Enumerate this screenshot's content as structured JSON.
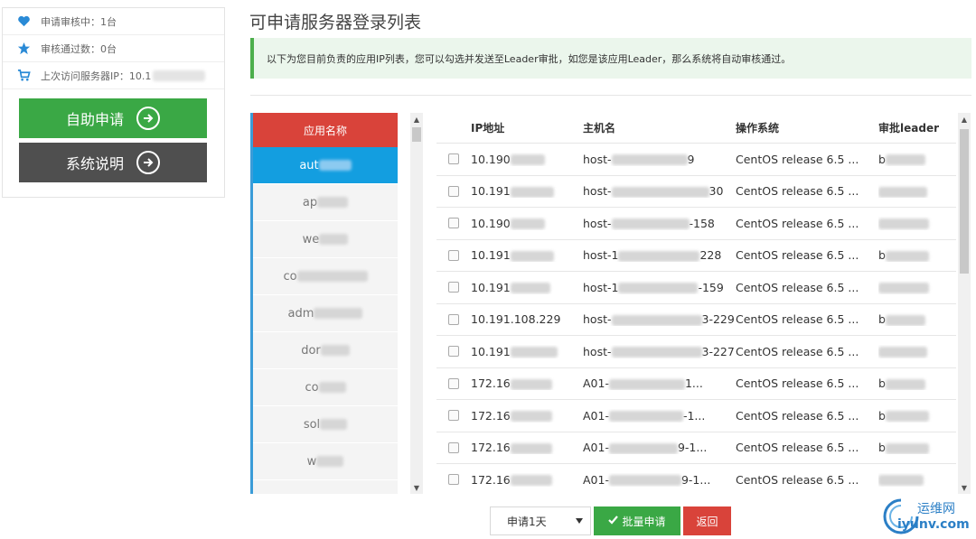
{
  "sidebar": {
    "stats": [
      {
        "icon": "heart-icon",
        "label": "申请审核中：1台"
      },
      {
        "icon": "star-icon",
        "label": "审核通过数：0台"
      },
      {
        "icon": "cart-icon",
        "label": "上次访问服务器IP：10.1"
      }
    ],
    "apply_button": "自助申请",
    "doc_button": "系统说明"
  },
  "page": {
    "title": "可申请服务器登录列表",
    "notice": "以下为您目前负责的应用IP列表，您可以勾选并发送至Leader审批，如您是该应用Leader，那么系统将自动审核通过。"
  },
  "apps": {
    "header": "应用名称",
    "items": [
      {
        "label": "aut",
        "active": true
      },
      {
        "label": "ap"
      },
      {
        "label": "we"
      },
      {
        "label": "co"
      },
      {
        "label": "adm"
      },
      {
        "label": "dor"
      },
      {
        "label": "co"
      },
      {
        "label": "sol"
      },
      {
        "label": "w"
      }
    ]
  },
  "table": {
    "headers": {
      "ip": "IP地址",
      "host": "主机名",
      "os": "操作系统",
      "leader": "审批leader"
    },
    "rows": [
      {
        "ip": "10.190",
        "host": "host-",
        "host_tail": "9",
        "os": "CentOS release 6.5 ...",
        "leader": "b"
      },
      {
        "ip": "10.191",
        "host": "host-",
        "host_tail": "30",
        "os": "CentOS release 6.5 ...",
        "leader": ""
      },
      {
        "ip": "10.190",
        "host": "host-",
        "host_tail": "-158",
        "os": "CentOS release 6.5 ...",
        "leader": ""
      },
      {
        "ip": "10.191",
        "host": "host-1",
        "host_tail": "228",
        "os": "CentOS release 6.5 ...",
        "leader": "b"
      },
      {
        "ip": "10.191",
        "host": "host-1",
        "host_tail": "-159",
        "os": "CentOS release 6.5 ...",
        "leader": ""
      },
      {
        "ip": "10.191.108.229",
        "host": "host-",
        "host_tail": "3-229",
        "os": "CentOS release 6.5 ...",
        "leader": "b"
      },
      {
        "ip": "10.191",
        "host": "host-",
        "host_tail": "3-227",
        "os": "CentOS release 6.5 ...",
        "leader": ""
      },
      {
        "ip": "172.16",
        "host": "A01-",
        "host_tail": "1...",
        "os": "CentOS release 6.5 ...",
        "leader": "b"
      },
      {
        "ip": "172.16",
        "host": "A01-",
        "host_tail": "-1...",
        "os": "CentOS release 6.5 ...",
        "leader": "b"
      },
      {
        "ip": "172.16",
        "host": "A01-",
        "host_tail": "9-1...",
        "os": "CentOS release 6.5 ...",
        "leader": "b"
      },
      {
        "ip": "172.16",
        "host": "A01-",
        "host_tail": "9-1...",
        "os": "CentOS release 6.5 ...",
        "leader": ""
      }
    ]
  },
  "controls": {
    "duration_selected": "申请1天",
    "batch_button": "批量申请",
    "back_button": "返回"
  },
  "watermark": {
    "line1": "运维网",
    "line2": "iyunv.com"
  },
  "colors": {
    "green": "#3aa845",
    "red": "#d9433a",
    "blue": "#139ee0",
    "dark": "#4f4f4f"
  }
}
